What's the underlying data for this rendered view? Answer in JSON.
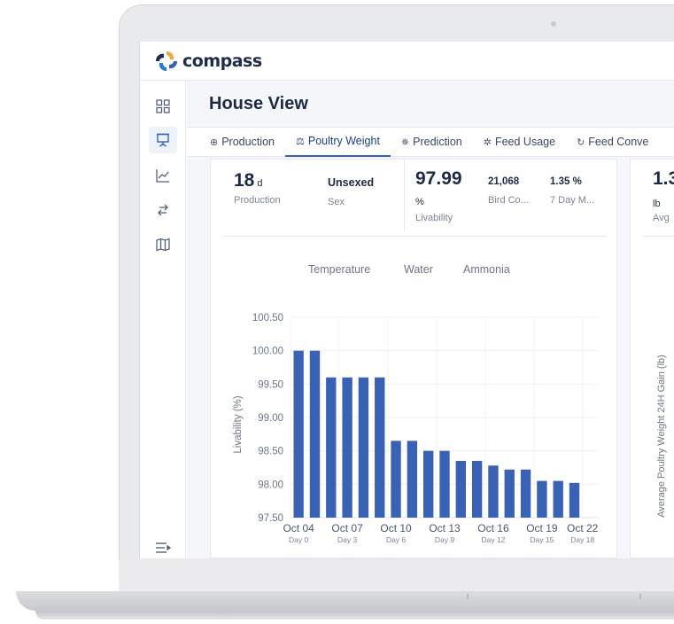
{
  "app": {
    "name": "compass"
  },
  "page": {
    "title": "House View"
  },
  "tabs": [
    {
      "label": "Production",
      "icon": "box-icon"
    },
    {
      "label": "Poultry Weight",
      "icon": "scale-icon",
      "active": true
    },
    {
      "label": "Prediction",
      "icon": "sparkle-icon"
    },
    {
      "label": "Feed Usage",
      "icon": "feed-icon"
    },
    {
      "label": "Feed Conve",
      "icon": "refresh-icon"
    }
  ],
  "kpis": {
    "production": {
      "value": "18",
      "unit": "d",
      "label": "Production"
    },
    "sex": {
      "value": "Unsexed",
      "label": "Sex"
    },
    "livability": {
      "value": "97.99",
      "unit": "%",
      "label": "Livability"
    },
    "bird_count": {
      "value": "21,068",
      "label": "Bird Co..."
    },
    "seven_day": {
      "value": "1.35 %",
      "label": "7 Day M..."
    },
    "avg": {
      "value": "1.3",
      "unit": "lb",
      "label": "Avg"
    }
  },
  "chart_toggles": [
    "Temperature",
    "Water",
    "Ammonia"
  ],
  "right_chart": {
    "ylabel": "Average Poultry Weight 24H Gain (lb)"
  },
  "colors": {
    "bar": "#3a62b4",
    "accent": "#3460c4"
  },
  "chart_data": {
    "type": "bar",
    "ylabel": "Livability (%)",
    "ylim": [
      97.5,
      100.5
    ],
    "yticks": [
      "97.50",
      "98.00",
      "98.50",
      "99.00",
      "99.50",
      "100.00",
      "100.50"
    ],
    "values": [
      100.0,
      100.0,
      99.6,
      99.6,
      99.6,
      99.6,
      98.65,
      98.65,
      98.5,
      98.5,
      98.35,
      98.35,
      98.28,
      98.22,
      98.22,
      98.05,
      98.05,
      98.02
    ],
    "xticks": [
      {
        "date": "Oct 04",
        "day": "Day 0",
        "index": 0
      },
      {
        "date": "Oct 07",
        "day": "Day 3",
        "index": 3
      },
      {
        "date": "Oct 10",
        "day": "Day 6",
        "index": 6
      },
      {
        "date": "Oct 13",
        "day": "Day 9",
        "index": 9
      },
      {
        "date": "Oct 16",
        "day": "Day 12",
        "index": 12
      },
      {
        "date": "Oct 19",
        "day": "Day 15",
        "index": 15
      },
      {
        "date": "Oct 22",
        "day": "Day 18",
        "index": 18
      }
    ]
  }
}
